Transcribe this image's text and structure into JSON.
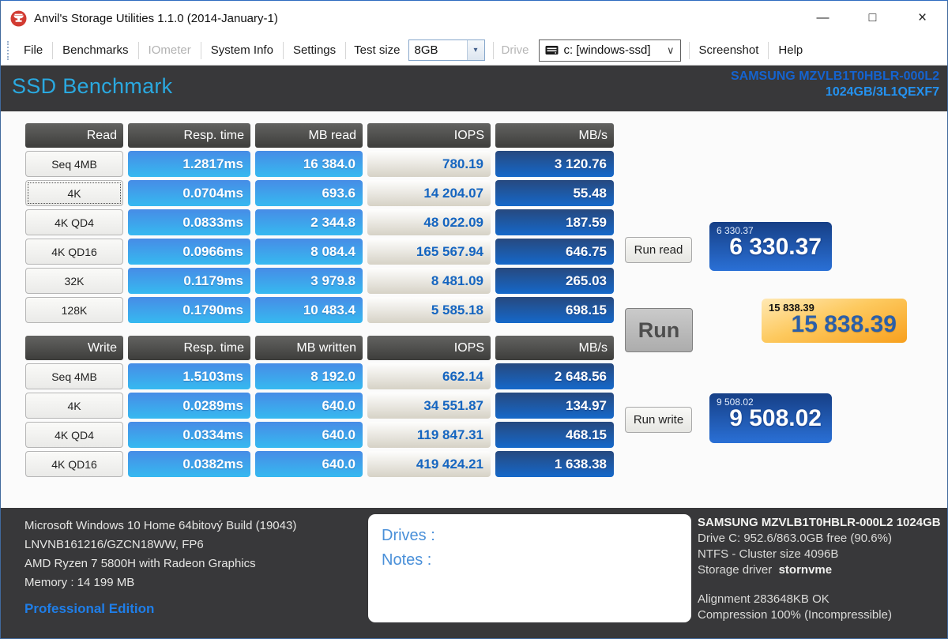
{
  "window": {
    "title": "Anvil's Storage Utilities 1.1.0 (2014-January-1)",
    "minimize_icon": "—",
    "maximize_icon": "□",
    "close_icon": "×"
  },
  "toolbar": {
    "menu_items": [
      {
        "label": "File",
        "enabled": true
      },
      {
        "label": "Benchmarks",
        "enabled": true
      },
      {
        "label": "IOmeter",
        "enabled": false
      },
      {
        "label": "System Info",
        "enabled": true
      },
      {
        "label": "Settings",
        "enabled": true
      }
    ],
    "test_size": {
      "label": "Test size",
      "value": "8GB",
      "dropdown_icon": "▾"
    },
    "drive": {
      "label": "Drive",
      "value": "c: [windows-ssd]",
      "chevron_icon": "∨"
    },
    "screenshot_label": "Screenshot",
    "help_label": "Help"
  },
  "banner": {
    "title": "SSD Benchmark",
    "device_model": "SAMSUNG MZVLB1T0HBLR-000L2",
    "device_capacity_fw": "1024GB/3L1QEXF7"
  },
  "read_table": {
    "headers": [
      "Read",
      "Resp. time",
      "MB read",
      "IOPS",
      "MB/s"
    ],
    "rows": [
      {
        "label": "Seq 4MB",
        "resp_time": "1.2817ms",
        "mb": "16 384.0",
        "iops": "780.19",
        "mbs": "3 120.76",
        "focused": false
      },
      {
        "label": "4K",
        "resp_time": "0.0704ms",
        "mb": "693.6",
        "iops": "14 204.07",
        "mbs": "55.48",
        "focused": true
      },
      {
        "label": "4K QD4",
        "resp_time": "0.0833ms",
        "mb": "2 344.8",
        "iops": "48 022.09",
        "mbs": "187.59",
        "focused": false
      },
      {
        "label": "4K QD16",
        "resp_time": "0.0966ms",
        "mb": "8 084.4",
        "iops": "165 567.94",
        "mbs": "646.75",
        "focused": false
      },
      {
        "label": "32K",
        "resp_time": "0.1179ms",
        "mb": "3 979.8",
        "iops": "8 481.09",
        "mbs": "265.03",
        "focused": false
      },
      {
        "label": "128K",
        "resp_time": "0.1790ms",
        "mb": "10 483.4",
        "iops": "5 585.18",
        "mbs": "698.15",
        "focused": false
      }
    ]
  },
  "write_table": {
    "headers": [
      "Write",
      "Resp. time",
      "MB written",
      "IOPS",
      "MB/s"
    ],
    "rows": [
      {
        "label": "Seq 4MB",
        "resp_time": "1.5103ms",
        "mb": "8 192.0",
        "iops": "662.14",
        "mbs": "2 648.56",
        "focused": false
      },
      {
        "label": "4K",
        "resp_time": "0.0289ms",
        "mb": "640.0",
        "iops": "34 551.87",
        "mbs": "134.97",
        "focused": false
      },
      {
        "label": "4K QD4",
        "resp_time": "0.0334ms",
        "mb": "640.0",
        "iops": "119 847.31",
        "mbs": "468.15",
        "focused": false
      },
      {
        "label": "4K QD16",
        "resp_time": "0.0382ms",
        "mb": "640.0",
        "iops": "419 424.21",
        "mbs": "1 638.38",
        "focused": false
      }
    ]
  },
  "actions": {
    "run_read": "Run read",
    "run": "Run",
    "run_write": "Run write"
  },
  "scores": {
    "read": {
      "label": "6 330.37",
      "value": "6 330.37"
    },
    "total": {
      "label": "15 838.39",
      "value": "15 838.39"
    },
    "write": {
      "label": "9 508.02",
      "value": "9 508.02"
    }
  },
  "footer": {
    "system_lines": [
      "Microsoft Windows 10 Home 64bitový Build (19043)",
      "LNVNB161216/GZCN18WW, FP6",
      "AMD Ryzen 7 5800H with Radeon Graphics",
      "Memory : 14 199 MB"
    ],
    "edition": "Professional Edition",
    "notes": {
      "drives_label": "Drives :",
      "notes_label": "Notes :"
    },
    "drive_model_line": "SAMSUNG MZVLB1T0HBLR-000L2 1024GB",
    "drive_lines": [
      "Drive C: 952.6/863.0GB free (90.6%)",
      "NTFS - Cluster size 4096B"
    ],
    "storage_driver_label": "Storage driver",
    "storage_driver_value": "stornvme",
    "extra_lines": [
      "Alignment 283648KB OK",
      "Compression 100% (Incompressible)"
    ]
  },
  "colors": {
    "banner_bg": "#38383a",
    "title_cyan": "#2aa9e0",
    "device_blue": "#1563cf",
    "device_light_blue": "#2492f0",
    "cell_blue_top": "#478ce6",
    "cell_blue_bottom": "#36b9f0",
    "cell_navy_top": "#27497f",
    "cell_navy_bottom": "#1568ca",
    "iops_text_blue": "#1565c0",
    "score_blue_top": "#163f86",
    "score_blue_bottom": "#2a70d6",
    "score_orange_top": "#ffe9b4",
    "score_orange_bottom": "#f8a01d",
    "score_orange_text": "#2b5fa8",
    "edition_blue": "#1f7ee8",
    "notes_blue": "#4a90d9"
  }
}
